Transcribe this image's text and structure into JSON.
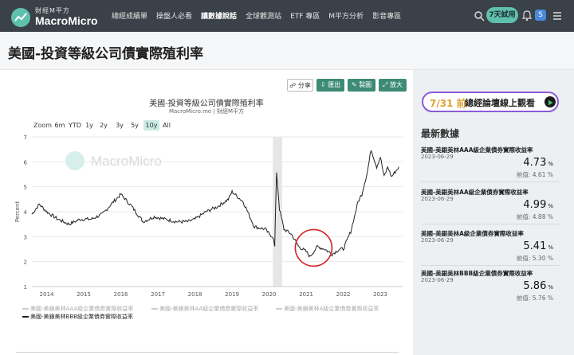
{
  "header": {
    "logo_cn": "財經M平方",
    "logo_en": "MacroMicro",
    "nav": [
      "總經成績單",
      "操盤人必看",
      "讓數據說話",
      "全球觀測站",
      "ETF 專區",
      "M平方分析",
      "影音專區"
    ],
    "active_nav": "讓數據說話",
    "trial_label": "7天試用",
    "avatar_letter": "S",
    "icons": [
      "search-icon",
      "bell-icon",
      "menu-icon"
    ]
  },
  "page": {
    "title": "美國-投資等級公司債實際殖利率"
  },
  "toolbar": {
    "share": "分享",
    "export": "匯出",
    "make": "製圖",
    "zoom": "放大"
  },
  "range": {
    "label": "Zoom",
    "options": [
      "6m",
      "YTD",
      "1y",
      "2y",
      "3y",
      "5y",
      "10y",
      "All"
    ],
    "selected": "10y"
  },
  "watermark": "MacroMicro",
  "chart_data": {
    "type": "line",
    "title": "美國-投資等級公司債實際殖利率",
    "subtitle": "MacroMicro.me | 財經M平方",
    "ylabel": "Percent",
    "ylim": [
      1,
      7
    ],
    "yticks": [
      1,
      2,
      3,
      4,
      5,
      6,
      7
    ],
    "xlim": [
      2013.6,
      2023.6
    ],
    "xticks": [
      "2014",
      "2015",
      "2016",
      "2017",
      "2018",
      "2019",
      "2020",
      "2021",
      "2022",
      "2023"
    ],
    "shaded_period": [
      2020.1,
      2020.35
    ],
    "highlight_circle": {
      "center": [
        2021.2,
        2.55
      ],
      "note": "red circle around the 2021 trough"
    },
    "legend": [
      {
        "name": "美國-美銀美林AAA級企業債券實際收益率",
        "visible": false
      },
      {
        "name": "美國-美銀美林AA級企業債券實際收益率",
        "visible": false
      },
      {
        "name": "美國-美銀美林A級企業債券實際收益率",
        "visible": false
      },
      {
        "name": "美國-美銀美林BBB級企業債券實際收益率",
        "visible": true
      }
    ],
    "series": [
      {
        "name": "美國-美銀美林BBB級企業債券實際收益率",
        "color": "#222222",
        "x": [
          2013.6,
          2013.8,
          2014.0,
          2014.3,
          2014.6,
          2014.9,
          2015.2,
          2015.5,
          2015.8,
          2016.0,
          2016.3,
          2016.6,
          2016.9,
          2017.2,
          2017.5,
          2017.8,
          2018.0,
          2018.3,
          2018.6,
          2018.9,
          2019.0,
          2019.3,
          2019.6,
          2019.9,
          2020.0,
          2020.1,
          2020.15,
          2020.2,
          2020.28,
          2020.4,
          2020.6,
          2020.8,
          2021.0,
          2021.1,
          2021.3,
          2021.5,
          2021.7,
          2021.9,
          2022.0,
          2022.2,
          2022.4,
          2022.5,
          2022.65,
          2022.75,
          2022.9,
          2023.0,
          2023.1,
          2023.2,
          2023.3,
          2023.5
        ],
        "y": [
          3.9,
          4.3,
          4.0,
          3.7,
          3.5,
          3.7,
          3.7,
          3.9,
          4.4,
          4.7,
          4.2,
          3.6,
          3.8,
          3.7,
          3.6,
          3.6,
          3.7,
          4.0,
          4.2,
          4.5,
          4.8,
          4.4,
          3.4,
          3.3,
          3.1,
          3.0,
          2.6,
          5.6,
          4.1,
          3.3,
          3.1,
          2.6,
          2.4,
          2.2,
          2.6,
          2.5,
          2.3,
          2.5,
          2.5,
          3.2,
          4.4,
          4.7,
          5.6,
          6.5,
          5.8,
          6.2,
          5.4,
          5.8,
          5.4,
          5.8
        ]
      }
    ]
  },
  "sidebar": {
    "promo_date": "7/31 前",
    "promo_text": "總經論壇線上觀看",
    "latest_title": "最新數據",
    "prev_label": "前值:",
    "unit": "%",
    "cards": [
      {
        "name": "美國-美銀美林AAA級企業債券實際收益率",
        "date": "2023-06-29",
        "value": "4.73",
        "prev": "4.61 %"
      },
      {
        "name": "美國-美銀美林AA級企業債券實際收益率",
        "date": "2023-06-29",
        "value": "4.99",
        "prev": "4.88 %"
      },
      {
        "name": "美國-美銀美林A級企業債券實際收益率",
        "date": "2023-06-29",
        "value": "5.41",
        "prev": "5.30 %"
      },
      {
        "name": "美國-美銀美林BBB級企業債券實際收益率",
        "date": "2023-06-29",
        "value": "5.86",
        "prev": "5.76 %"
      }
    ]
  }
}
